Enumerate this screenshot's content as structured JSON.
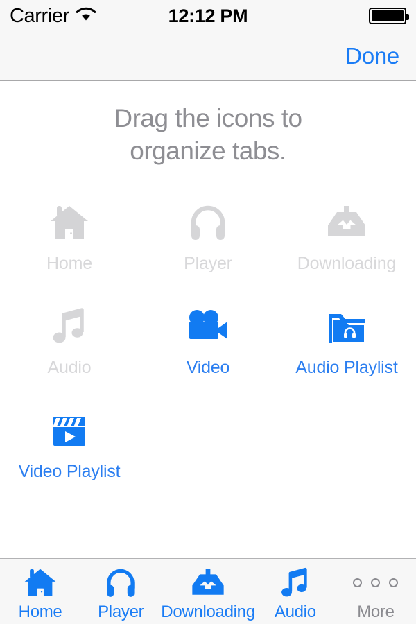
{
  "status_bar": {
    "carrier": "Carrier",
    "wifi_icon": "wifi-icon",
    "time": "12:12 PM",
    "battery_icon": "battery-full-icon"
  },
  "nav_bar": {
    "done_label": "Done",
    "done_color": "#1a7cf5"
  },
  "content": {
    "instruction_line1": "Drag the icons to",
    "instruction_line2": "organize tabs.",
    "instruction_color": "#8e8e93",
    "grid": [
      {
        "label": "Home",
        "icon": "home-icon",
        "state": "disabled",
        "color": "#d8d8da"
      },
      {
        "label": "Player",
        "icon": "headphones-icon",
        "state": "disabled",
        "color": "#d8d8da"
      },
      {
        "label": "Downloading",
        "icon": "download-tray-icon",
        "state": "disabled",
        "color": "#d8d8da"
      },
      {
        "label": "Audio",
        "icon": "music-note-icon",
        "state": "disabled",
        "color": "#d8d8da"
      },
      {
        "label": "Video",
        "icon": "movie-camera-icon",
        "state": "active",
        "color": "#2b7ef0"
      },
      {
        "label": "Audio Playlist",
        "icon": "folder-headphones-icon",
        "state": "active",
        "color": "#2b7ef0"
      },
      {
        "label": "Video Playlist",
        "icon": "clapperboard-icon",
        "state": "active",
        "color": "#2b7ef0"
      }
    ]
  },
  "tab_bar": {
    "tabs": [
      {
        "label": "Home",
        "icon": "home-icon",
        "state": "active",
        "color": "#1a7cf5"
      },
      {
        "label": "Player",
        "icon": "headphones-icon",
        "state": "active",
        "color": "#1a7cf5"
      },
      {
        "label": "Downloading",
        "icon": "download-tray-icon",
        "state": "active",
        "color": "#1a7cf5"
      },
      {
        "label": "Audio",
        "icon": "music-note-icon",
        "state": "active",
        "color": "#1a7cf5"
      },
      {
        "label": "More",
        "icon": "more-dots-icon",
        "state": "more",
        "color": "#8b8b90"
      }
    ]
  }
}
